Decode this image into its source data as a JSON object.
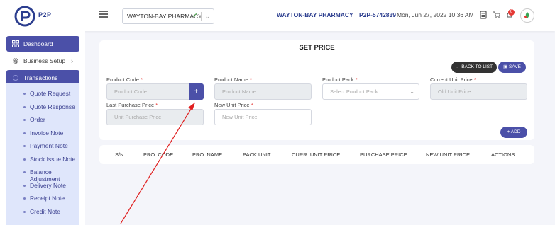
{
  "header": {
    "logo_text": "P2P",
    "branch": "WAYTON-BAY PHARMACY",
    "pharmacy_name": "WAYTON-BAY PHARMACY",
    "pharmacy_code": "P2P-5742839",
    "datetime": "Mon, Jun 27, 2022 10:36 AM",
    "notif_count": "0"
  },
  "sidebar": {
    "dashboard": "Dashboard",
    "business_setup": "Business Setup",
    "transactions": "Transactions",
    "sub_items": [
      "Quote Request",
      "Quote Response",
      "Order",
      "Invoice Note",
      "Payment Note",
      "Stock Issue Note",
      "Balance Adjustment",
      "Delivery Note",
      "Receipt Note",
      "Credit Note"
    ]
  },
  "form": {
    "title": "SET PRICE",
    "back_label": "BACK TO LIST",
    "save_label": "SAVE",
    "add_label": "ADD",
    "product_code_label": "Product Code",
    "product_code_placeholder": "Product Code",
    "product_name_label": "Product Name",
    "product_name_placeholder": "Product Name",
    "product_pack_label": "Product Pack",
    "product_pack_placeholder": "Select Product Pack",
    "current_price_label": "Current Unit Price",
    "current_price_placeholder": "Old Unit Price",
    "last_price_label": "Last Purchase Price",
    "last_price_placeholder": "Unit Purchase Price",
    "new_price_label": "New Unit Price",
    "new_price_placeholder": "New Unit Price",
    "required_mark": "*"
  },
  "table": {
    "columns": [
      "S/N",
      "PRO. CODE",
      "PRO. NAME",
      "PACK UNIT",
      "CURR. UNIT PRICE",
      "PURCHASE PRICE",
      "NEW UNIT PRICE",
      "ACTIONS"
    ]
  },
  "colors": {
    "primary": "#4b50a8",
    "dark_button": "#333333",
    "sidebar_sub_bg": "#dfe6fb",
    "annotation": "#e02020"
  }
}
